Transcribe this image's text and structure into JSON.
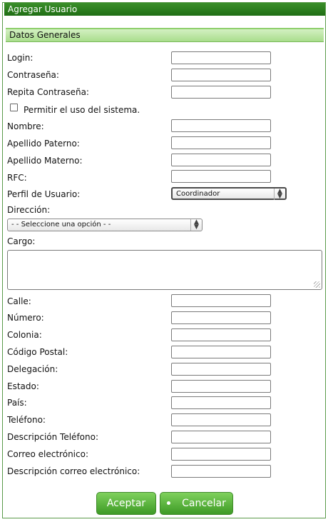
{
  "window": {
    "title": "Agregar Usuario"
  },
  "section": {
    "title": "Datos Generales"
  },
  "fields_top": [
    {
      "label": "Login:",
      "value": ""
    },
    {
      "label": "Contraseña:",
      "value": ""
    },
    {
      "label": "Repita Contraseña:",
      "value": ""
    }
  ],
  "permission": {
    "label": "Permitir el uso del sistema.",
    "checked": false
  },
  "fields_mid": [
    {
      "label": "Nombre:",
      "value": ""
    },
    {
      "label": "Apellido Paterno:",
      "value": ""
    },
    {
      "label": "Apellido Materno:",
      "value": ""
    },
    {
      "label": "RFC:",
      "value": ""
    }
  ],
  "perfil": {
    "label": "Perfil de Usuario:",
    "selected": "Coordinador"
  },
  "direccion": {
    "label": "Dirección:",
    "selected": "- - Seleccione una opción - -"
  },
  "cargo": {
    "label": "Cargo:",
    "value": ""
  },
  "fields_address": [
    {
      "label": "Calle:",
      "value": ""
    },
    {
      "label": "Número:",
      "value": ""
    },
    {
      "label": "Colonia:",
      "value": ""
    },
    {
      "label": "Código Postal:",
      "value": ""
    },
    {
      "label": "Delegación:",
      "value": ""
    },
    {
      "label": "Estado:",
      "value": ""
    },
    {
      "label": "País:",
      "value": ""
    },
    {
      "label": "Teléfono:",
      "value": ""
    },
    {
      "label": "Descripción Teléfono:",
      "value": ""
    },
    {
      "label": "Correo electrónico:",
      "value": ""
    },
    {
      "label": "Descripción correo electrónico:",
      "value": ""
    }
  ],
  "buttons": {
    "accept": "Aceptar",
    "cancel": "Cancelar"
  },
  "colors": {
    "accent": "#2f7f1f",
    "button": "#5cb83e",
    "section": "#b8e4a0"
  },
  "icons": {
    "select_arrow": "updown-chevron-icon",
    "cancel_bullet": "bullet-icon",
    "resize": "resize-grip-icon"
  }
}
